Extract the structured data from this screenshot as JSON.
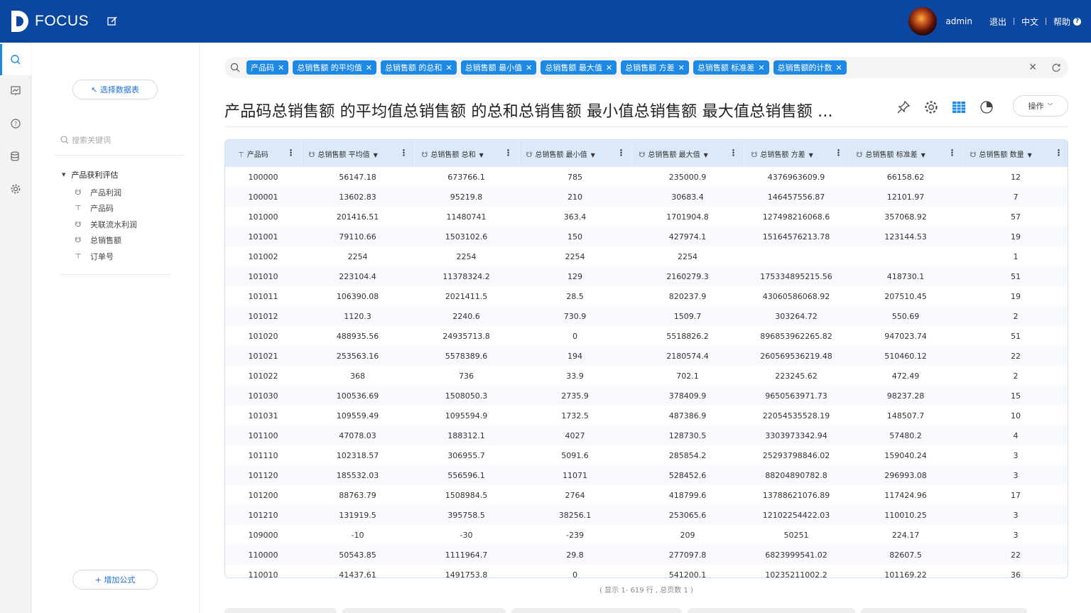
{
  "header": {
    "logo_text": "FOCUS",
    "user": "admin",
    "logout": "退出",
    "language": "中文",
    "help": "帮助"
  },
  "sidebar": {
    "select_table_button": "↖ 选择数据表",
    "search_placeholder": "搜索关键词",
    "group_label": "产品获利评估",
    "fields": [
      {
        "label": "产品利润",
        "icon": "measure-icon"
      },
      {
        "label": "产品码",
        "icon": "attribute-icon"
      },
      {
        "label": "关联流水利润",
        "icon": "measure-icon"
      },
      {
        "label": "总销售额",
        "icon": "measure-icon"
      },
      {
        "label": "订单号",
        "icon": "attribute-icon"
      }
    ],
    "add_formula_button": "+ 增加公式"
  },
  "search": {
    "chips": [
      "产品码",
      "总销售额 的平均值",
      "总销售额 的总和",
      "总销售额 最小值",
      "总销售额 最大值",
      "总销售额 方差",
      "总销售额 标准差",
      "总销售额的计数"
    ]
  },
  "main": {
    "title": "产品码总销售额 的平均值总销售额 的总和总销售额 最小值总销售额 最大值总销售额 ...",
    "ops_button": "操作"
  },
  "table": {
    "columns": [
      "产品码",
      "总销售额 平均值",
      "总销售额 总和",
      "总销售额 最小值",
      "总销售额 最大值",
      "总销售额 方差",
      "总销售额 标准差",
      "总销售额 数量"
    ],
    "rows": [
      [
        "100000",
        "56147.18",
        "673766.1",
        "785",
        "235000.9",
        "4376963609.9",
        "66158.62",
        "12"
      ],
      [
        "100001",
        "13602.83",
        "95219.8",
        "210",
        "30683.4",
        "146457556.87",
        "12101.97",
        "7"
      ],
      [
        "101000",
        "201416.51",
        "11480741",
        "363.4",
        "1701904.8",
        "127498216068.6",
        "357068.92",
        "57"
      ],
      [
        "101001",
        "79110.66",
        "1503102.6",
        "150",
        "427974.1",
        "15164576213.78",
        "123144.53",
        "19"
      ],
      [
        "101002",
        "2254",
        "2254",
        "2254",
        "2254",
        "",
        "",
        "1"
      ],
      [
        "101010",
        "223104.4",
        "11378324.2",
        "129",
        "2160279.3",
        "175334895215.56",
        "418730.1",
        "51"
      ],
      [
        "101011",
        "106390.08",
        "2021411.5",
        "28.5",
        "820237.9",
        "43060586068.92",
        "207510.45",
        "19"
      ],
      [
        "101012",
        "1120.3",
        "2240.6",
        "730.9",
        "1509.7",
        "303264.72",
        "550.69",
        "2"
      ],
      [
        "101020",
        "488935.56",
        "24935713.8",
        "0",
        "5518826.2",
        "896853962265.82",
        "947023.74",
        "51"
      ],
      [
        "101021",
        "253563.16",
        "5578389.6",
        "194",
        "2180574.4",
        "260569536219.48",
        "510460.12",
        "22"
      ],
      [
        "101022",
        "368",
        "736",
        "33.9",
        "702.1",
        "223245.62",
        "472.49",
        "2"
      ],
      [
        "101030",
        "100536.69",
        "1508050.3",
        "2735.9",
        "378409.9",
        "9650563971.73",
        "98237.28",
        "15"
      ],
      [
        "101031",
        "109559.49",
        "1095594.9",
        "1732.5",
        "487386.9",
        "22054535528.19",
        "148507.7",
        "10"
      ],
      [
        "101100",
        "47078.03",
        "188312.1",
        "4027",
        "128730.5",
        "3303973342.94",
        "57480.2",
        "4"
      ],
      [
        "101110",
        "102318.57",
        "306955.7",
        "5091.6",
        "285854.2",
        "25293798846.02",
        "159040.24",
        "3"
      ],
      [
        "101120",
        "185532.03",
        "556596.1",
        "11071",
        "528452.6",
        "88204890782.8",
        "296993.08",
        "3"
      ],
      [
        "101200",
        "88763.79",
        "1508984.5",
        "2764",
        "418799.6",
        "13788621076.89",
        "117424.96",
        "17"
      ],
      [
        "101210",
        "131919.5",
        "395758.5",
        "38256.1",
        "253065.6",
        "12102254422.03",
        "110010.25",
        "3"
      ],
      [
        "109000",
        "-10",
        "-30",
        "-239",
        "209",
        "50251",
        "224.17",
        "3"
      ],
      [
        "110000",
        "50543.85",
        "1111964.7",
        "29.8",
        "277097.8",
        "6823999541.02",
        "82607.5",
        "22"
      ],
      [
        "110010",
        "41437.61",
        "1491753.8",
        "0",
        "541200.1",
        "10235211002.2",
        "101169.22",
        "36"
      ]
    ]
  },
  "pager_text": "( 显示 1- 619 行 , 总页数 1 )"
}
